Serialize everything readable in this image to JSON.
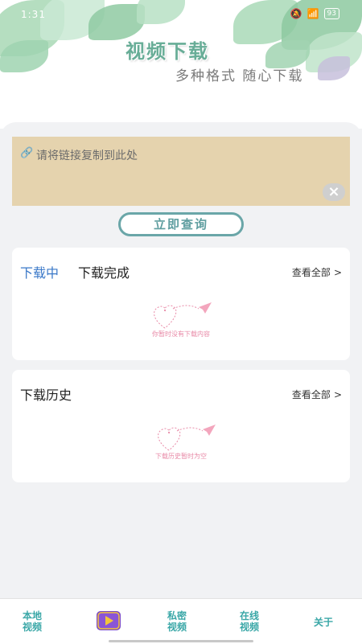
{
  "status_bar": {
    "time": "1:31",
    "battery": "93"
  },
  "header": {
    "title": "视频下载",
    "subtitle": "多种格式 随心下载"
  },
  "input": {
    "placeholder": "请将链接复制到此处",
    "link_icon": "link-icon",
    "clear_icon": "close-icon"
  },
  "query_button": {
    "label": "立即查询"
  },
  "download_panel": {
    "tabs": [
      {
        "label": "下载中",
        "active": true
      },
      {
        "label": "下载完成",
        "active": false
      }
    ],
    "view_all": "查看全部",
    "empty_text": "你暂时没有下载内容"
  },
  "history_panel": {
    "title": "下载历史",
    "view_all": "查看全部",
    "empty_text": "下载历史暂时为空"
  },
  "bottom_nav": {
    "items": [
      {
        "line1": "本地",
        "line2": "视频"
      },
      {
        "icon": "play-icon"
      },
      {
        "line1": "私密",
        "line2": "视频"
      },
      {
        "line1": "在线",
        "line2": "视频"
      },
      {
        "line1": "关于",
        "line2": ""
      }
    ]
  },
  "colors": {
    "accent_blue": "#3a78c8",
    "teal": "#3aa7a7",
    "input_bg": "#e5d3ae",
    "pink": "#e88aa7",
    "play_purple": "#7a4ac7"
  }
}
